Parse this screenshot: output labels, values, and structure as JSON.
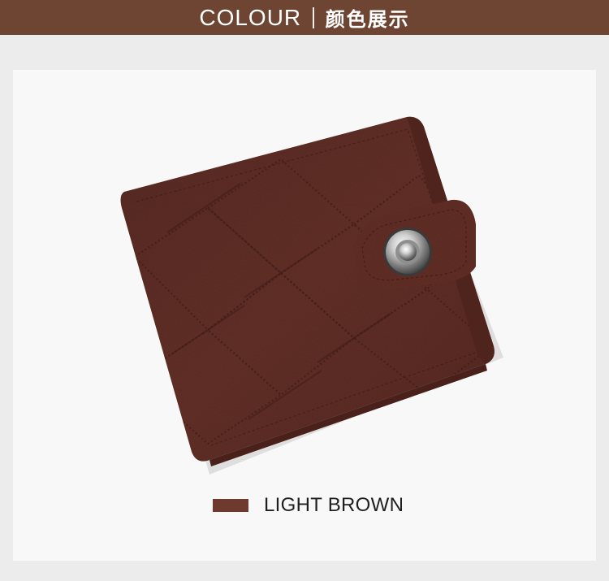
{
  "header": {
    "title_en": "COLOUR",
    "title_zh": "颜色展示",
    "background": "#6e4532"
  },
  "product": {
    "image": "brown-leather-wallet-image",
    "color_name": "LIGHT BROWN",
    "swatch_color": "#6e3a2f"
  }
}
